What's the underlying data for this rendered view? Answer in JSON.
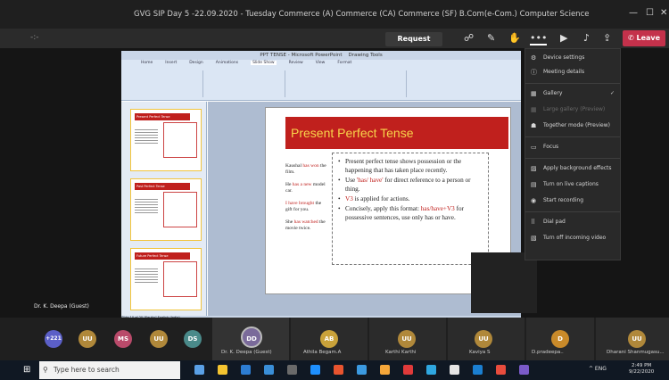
{
  "window": {
    "title": "GVG SIP Day 5 -22.09.2020 - Tuesday Commerce (A) Commerce (CA) Commerce (SF) B.Com(e-Com.) Computer Science IT",
    "minimize": "—",
    "maximize": "☐",
    "close": "✕"
  },
  "toolbar": {
    "dash": "-:-",
    "request_control": "Request control",
    "leave": "Leave",
    "icons": [
      "people-icon",
      "chat-icon",
      "raise-hand-icon",
      "more-icon",
      "camera-off-icon",
      "mic-off-icon",
      "share-icon"
    ]
  },
  "ppt": {
    "app_title": "PPT TENSE - Microsoft PowerPoint",
    "tab_label": "Drawing Tools",
    "ribbon_tabs": [
      "Home",
      "Insert",
      "Design",
      "Animations",
      "Slide Show",
      "Review",
      "View",
      "Format"
    ],
    "thumb_titles": [
      "Present Perfect Tense",
      "Past Perfect Tense",
      "Future Perfect Tense"
    ],
    "slide": {
      "title": "Present Perfect Tense",
      "examples": [
        {
          "pre": "Kaushal ",
          "hl": "has won",
          "post": " the film."
        },
        {
          "pre": "He ",
          "hl": "has a new",
          "post": " model car."
        },
        {
          "pre": "",
          "hl": "I have brought",
          "post": " the gift for you."
        },
        {
          "pre": "She ",
          "hl": "has watched",
          "post": " the movie twice."
        }
      ],
      "bullets": [
        {
          "text": "Present perfect tense shows possession or the happening that has taken place recently."
        },
        {
          "pre": "Use ",
          "hl": "'has/ have'",
          "post": " for direct reference to a person or thing."
        },
        {
          "pre": "",
          "hl": "V3",
          "post": " is applied for actions."
        },
        {
          "pre": "Concisely, apply this format: ",
          "hl": "has/have+V3",
          "post": " for possessive sentences, use only has or have."
        }
      ]
    },
    "status": "Slide 10 of 20   \"Equity\"   English (India)"
  },
  "menu": {
    "items": [
      {
        "icon": "⚙",
        "label": "Device settings",
        "dim": false
      },
      {
        "icon": "ⓘ",
        "label": "Meeting details",
        "dim": false
      },
      {
        "icon": "▦",
        "label": "Gallery",
        "dim": false,
        "checked": true
      },
      {
        "icon": "▦",
        "label": "Large gallery (Preview)",
        "dim": true
      },
      {
        "icon": "☗",
        "label": "Together mode (Preview)",
        "dim": false
      },
      {
        "icon": "▭",
        "label": "Focus",
        "dim": false
      },
      {
        "icon": "▨",
        "label": "Apply background effects",
        "dim": false
      },
      {
        "icon": "▤",
        "label": "Turn on live captions",
        "dim": false
      },
      {
        "icon": "◉",
        "label": "Start recording",
        "dim": false
      },
      {
        "icon": "⠿",
        "label": "Dial pad",
        "dim": false
      },
      {
        "icon": "▧",
        "label": "Turn off incoming video",
        "dim": false
      }
    ]
  },
  "presenter": "Dr. K. Deepa (Guest)",
  "participants": [
    {
      "initials": "+221",
      "color": "#5b5fc7",
      "label": ""
    },
    {
      "initials": "UU",
      "color": "#b0883a",
      "label": ""
    },
    {
      "initials": "MS",
      "color": "#b94a6a",
      "label": ""
    },
    {
      "initials": "UU",
      "color": "#b0883a",
      "label": ""
    },
    {
      "initials": "DS",
      "color": "#4a8a8a",
      "label": ""
    },
    {
      "initials": "DD",
      "color": "#7a6a9a",
      "label": "Dr. K. Deepa (Guest)"
    },
    {
      "initials": "AB",
      "color": "#c9a23a",
      "label": "Athila Begam.A"
    },
    {
      "initials": "UU",
      "color": "#b0883a",
      "label": "Karthi Karthi"
    },
    {
      "initials": "UU",
      "color": "#b0883a",
      "label": "Kaviya S"
    },
    {
      "initials": "D",
      "color": "#c98a2a",
      "label": "D.pradeepa.."
    },
    {
      "initials": "UU",
      "color": "#b0883a",
      "label": "Dharani Shanmugasu..."
    }
  ],
  "taskbar": {
    "search_placeholder": "Type here to search",
    "tray": "^  ENG",
    "time": "2:49 PM",
    "date": "9/22/2020",
    "app_colors": [
      "#5aa0e6",
      "#f4c430",
      "#2d7dd2",
      "#3a8fd8",
      "#6a6a6a",
      "#1e90ff",
      "#e8542f",
      "#3b9ae1",
      "#f4a63a",
      "#e03a3a",
      "#2fa7e0",
      "#e5e5e5",
      "#1b7fd1",
      "#e84c3d",
      "#7a5ac8"
    ]
  }
}
